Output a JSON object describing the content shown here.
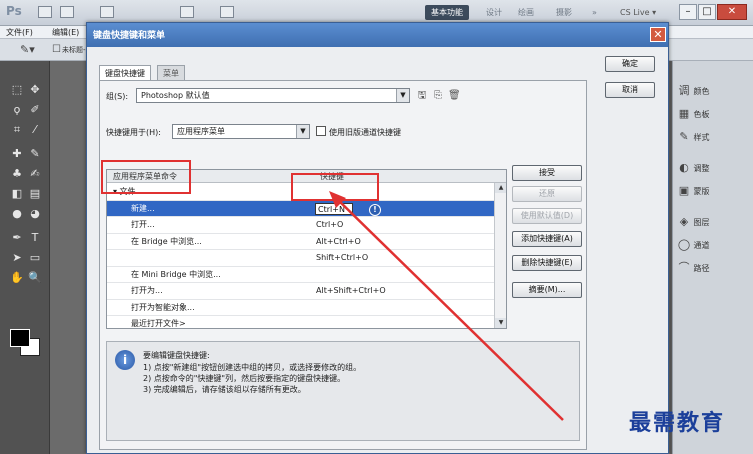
{
  "ps": {
    "logo": "Ps",
    "workspaces": [
      "基本功能",
      "设计",
      "绘画",
      "摄影",
      "»"
    ],
    "cslive": "CS Live ▾",
    "menu": [
      "文件(F)",
      "编辑(E)"
    ],
    "doc_tab": "未标题-1"
  },
  "panels": [
    {
      "icon": "调",
      "label": "颜色"
    },
    {
      "icon": "▦",
      "label": "色板"
    },
    {
      "icon": "✎",
      "label": "样式"
    },
    {
      "icon": "◐",
      "label": "调整"
    },
    {
      "icon": "▣",
      "label": "蒙版"
    },
    {
      "icon": "◈",
      "label": "图层"
    },
    {
      "icon": "◯",
      "label": "通道"
    },
    {
      "icon": "⌒",
      "label": "路径"
    }
  ],
  "dialog": {
    "title": "键盘快捷键和菜单",
    "close": "✕",
    "tabs": [
      "键盘快捷键",
      "菜单"
    ],
    "set_label": "组(S):",
    "set_value": "Photoshop 默认值",
    "shortcuts_for_label": "快捷键用于(H):",
    "shortcuts_for_value": "应用程序菜单",
    "legacy_checkbox": "使用旧版通道快捷键",
    "table_headers": [
      "应用程序菜单命令",
      "快捷键"
    ],
    "rows": [
      {
        "cmd": "▾ 文件",
        "key": "",
        "group": true
      },
      {
        "cmd": "新建...",
        "key": "Ctrl+N",
        "selected": true
      },
      {
        "cmd": "打开...",
        "key": "Ctrl+O"
      },
      {
        "cmd": "在 Bridge 中浏览...",
        "key": "Alt+Ctrl+O"
      },
      {
        "cmd": "",
        "key": "Shift+Ctrl+O"
      },
      {
        "cmd": "在 Mini Bridge 中浏览...",
        "key": ""
      },
      {
        "cmd": "打开为...",
        "key": "Alt+Shift+Ctrl+O"
      },
      {
        "cmd": "打开为智能对象...",
        "key": ""
      },
      {
        "cmd": "最近打开文件>",
        "key": ""
      }
    ],
    "side_buttons": [
      {
        "label": "接受",
        "disabled": false
      },
      {
        "label": "还原",
        "disabled": true
      },
      {
        "label": "使用默认值(D)",
        "disabled": true
      },
      {
        "label": "添加快捷键(A)",
        "disabled": false
      },
      {
        "label": "删除快捷键(E)",
        "disabled": false
      },
      {
        "label": "摘要(M)...",
        "disabled": false
      }
    ],
    "ok": "确定",
    "cancel": "取消",
    "info_title": "要编辑键盘快捷键:",
    "info_lines": [
      "1) 点按\"新建组\"按钮创建选中组的拷贝，或选择要修改的组。",
      "2) 点按命令的\"快捷键\"列，然后按要指定的键盘快捷键。",
      "3) 完成编辑后，请存储该组以存储所有更改。"
    ]
  },
  "watermark": "最需教育"
}
